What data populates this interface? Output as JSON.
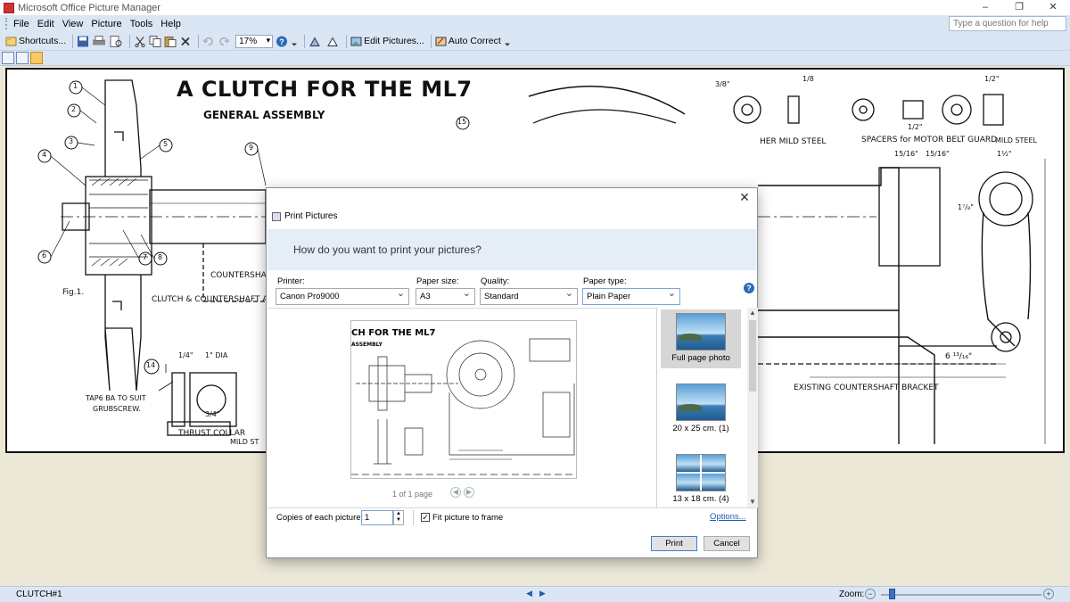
{
  "window": {
    "title": "Microsoft Office Picture Manager",
    "controls": [
      "–",
      "❐",
      "✕"
    ]
  },
  "menubar": {
    "items": [
      "File",
      "Edit",
      "View",
      "Picture",
      "Tools",
      "Help"
    ],
    "help_placeholder": "Type a question for help"
  },
  "toolbar": {
    "shortcuts_label": "Shortcuts...",
    "zoom_value": "17%",
    "edit_pictures_label": "Edit Pictures...",
    "auto_correct_label": "Auto Correct"
  },
  "drawing": {
    "title": "A CLUTCH FOR THE ML7",
    "subtitle": "GENERAL ASSEMBLY",
    "fig_label": "Fig.1.",
    "assembly_label": "CLUTCH & COUNTERSHAFT ASS",
    "countershaft_label": "COUNTERSHAFT E",
    "mild_steel_1": "HER MILD STEEL",
    "spacers_label": "SPACERS for MOTOR BELT GUARD",
    "spacers_material": "MILD STEEL",
    "bracket_label": "EXISTING COUNTERSHAFT BRACKET",
    "thrust_collar": "THRUST COLLAR",
    "thrust_material": "MILD ST",
    "tap_label": "TAP6 BA TO SUIT",
    "grubscrew": "GRUBSCREW.",
    "dia_label": "1\" DIA",
    "dim_34": "3/4\"",
    "dim_14": "1/4\"",
    "dim_15_16a": "15/16\"",
    "dim_15_16b": "15/16\"",
    "dim_1_half": "1½\"",
    "dim_1_78": "1⁷/₈\"",
    "dim_bracket": "6 ¹³/₁₆\"",
    "dim_18": "1/8",
    "dim_38": "3/8\"",
    "dim_12a": "1/2\"",
    "dim_12b": "1/2\"",
    "callout_1": "1",
    "callout_2": "2",
    "callout_3": "3",
    "callout_4": "4",
    "callout_5": "5",
    "callout_6": "6",
    "callout_7": "7",
    "callout_8": "8",
    "callout_9": "9",
    "callout_14": "14",
    "callout_15": "15"
  },
  "dialog": {
    "title": "Print Pictures",
    "question": "How do you want to print your pictures?",
    "printer_label": "Printer:",
    "printer_value": "Canon Pro9000",
    "paper_size_label": "Paper size:",
    "paper_size_value": "A3",
    "quality_label": "Quality:",
    "quality_value": "Standard",
    "paper_type_label": "Paper type:",
    "paper_type_value": "Plain Paper",
    "preview_title": "CH FOR THE ML7",
    "preview_subtitle": "ASSEMBLY",
    "page_info": "1 of 1 page",
    "layouts": [
      {
        "label": "Full page photo",
        "selected": true
      },
      {
        "label": "20 x 25 cm. (1)",
        "selected": false
      },
      {
        "label": "13 x 18 cm. (4)",
        "selected": false
      }
    ],
    "copies_label": "Copies of each picture:",
    "copies_value": "1",
    "fit_label": "Fit picture to frame",
    "fit_checked": true,
    "options_label": "Options...",
    "print_label": "Print",
    "cancel_label": "Cancel"
  },
  "statusbar": {
    "filename": "CLUTCH#1",
    "zoom_label": "Zoom:",
    "zoom_fraction": 0.05
  }
}
